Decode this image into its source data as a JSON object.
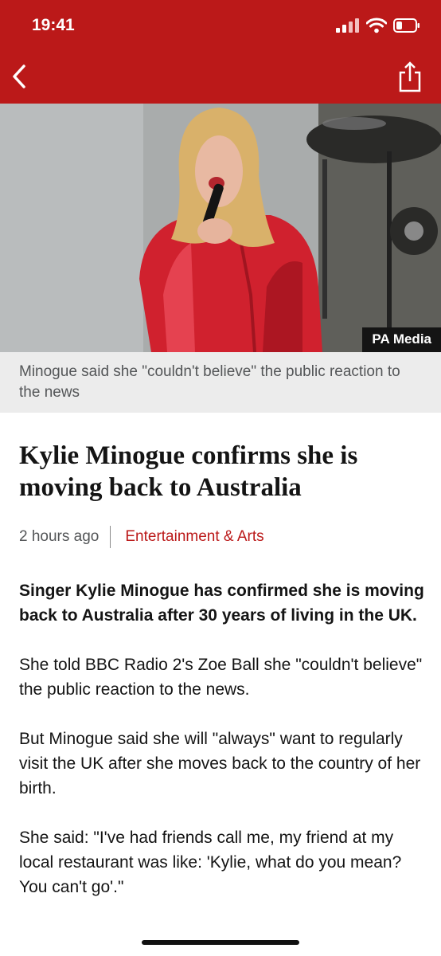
{
  "status_bar": {
    "time": "19:41"
  },
  "nav": {
    "back_icon": "chevron-left-icon",
    "share_icon": "share-icon"
  },
  "colors": {
    "brand_red": "#bb1919",
    "text": "#141414",
    "meta_grey": "#545658"
  },
  "image": {
    "credit": "PA Media",
    "caption": "Minogue said she \"couldn't believe\" the public reaction to the news"
  },
  "article": {
    "headline": "Kylie Minogue confirms she is moving back to Australia",
    "timestamp": "2 hours ago",
    "section": "Entertainment & Arts",
    "paragraphs": [
      "Singer Kylie Minogue has confirmed she is moving back to Australia after 30 years of living in the UK.",
      "She told BBC Radio 2's Zoe Ball she \"couldn't believe\" the public reaction to the news.",
      "But Minogue said she will \"always\" want to regularly visit the UK after she moves back to the country of her birth.",
      "She said: \"I've had friends call me, my friend at my local restaurant was like: 'Kylie, what do you mean? You can't go'.\""
    ]
  }
}
